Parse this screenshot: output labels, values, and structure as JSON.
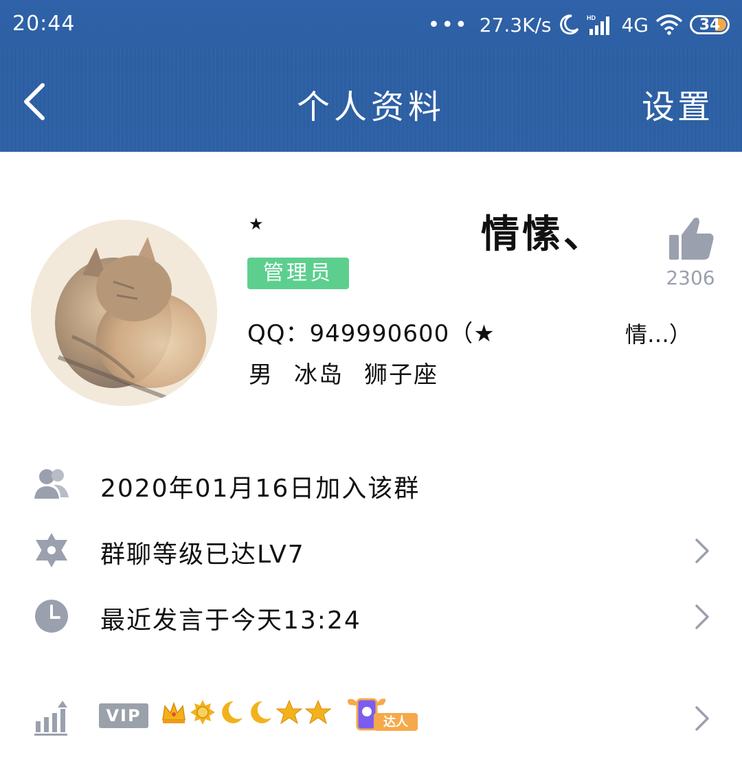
{
  "status_bar": {
    "time": "20:44",
    "dots": "•••",
    "speed": "27.3K/s",
    "network": "4G",
    "battery": "34",
    "icons": [
      "moon-icon",
      "signal-icon",
      "wifi-icon",
      "battery-icon"
    ]
  },
  "nav": {
    "back_icon": "chevron-left-icon",
    "title": "个人资料",
    "settings_label": "设置"
  },
  "profile": {
    "name_prefix": "★",
    "name": "情愫、",
    "role_badge": "管理员",
    "likes": "2306",
    "qq_line": "QQ：949990600（★",
    "qq_nick_end": "情…）",
    "gender": "男",
    "location": "冰岛",
    "zodiac": "狮子座"
  },
  "rows": [
    {
      "icon": "group-members-icon",
      "text": "2020年01月16日加入该群",
      "has_arrow": false
    },
    {
      "icon": "star-of-david-icon",
      "text": "群聊等级已达LV7",
      "has_arrow": true
    },
    {
      "icon": "clock-icon",
      "text": "最近发言于今天13:24",
      "has_arrow": true
    }
  ],
  "vip_row": {
    "icon": "chart-up-icon",
    "vip_label": "VIP",
    "level_icons": [
      "crown-icon",
      "sun-icon",
      "moon-icon",
      "moon-icon",
      "star-icon",
      "star-icon"
    ],
    "daren_label": "达人"
  },
  "colors": {
    "header_blue": "#2d61a6",
    "badge_green": "#5ccf8e",
    "icon_gray": "#9aa0ad",
    "gold": "#f2b21c"
  }
}
